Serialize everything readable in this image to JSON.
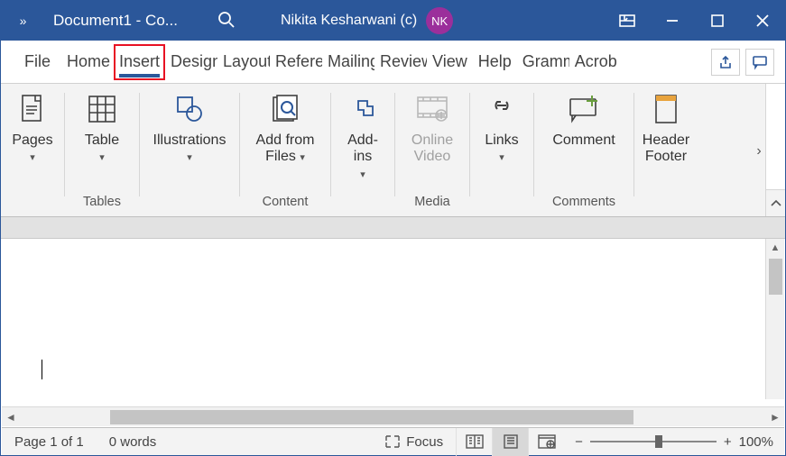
{
  "titlebar": {
    "overflow_glyph": "»",
    "doc_title": "Document1  -  Co...",
    "user_name": "Nikita Kesharwani (c)",
    "avatar_initials": "NK"
  },
  "tabs": {
    "file": "File",
    "items": [
      "Home",
      "Insert",
      "Design",
      "Layout",
      "Refere",
      "Mailing",
      "Review",
      "View",
      "Help",
      "Gramm",
      "Acrob"
    ],
    "active_index": 1
  },
  "ribbon": {
    "pages": {
      "label": "Pages"
    },
    "tables": {
      "group": "Tables",
      "table": "Table"
    },
    "illustrations": {
      "label": "Illustrations"
    },
    "content": {
      "group": "Content",
      "add_from_files": "Add from Files"
    },
    "addins": {
      "label": "Add-ins"
    },
    "media": {
      "group": "Media",
      "online_video": "Online Video"
    },
    "links": {
      "label": "Links"
    },
    "comments": {
      "group": "Comments",
      "comment": "Comment"
    },
    "header_footer": {
      "label": "Header Footer"
    }
  },
  "status": {
    "page_info": "Page 1 of 1",
    "word_count": "0 words",
    "focus_label": "Focus",
    "zoom_pct": "100%",
    "zoom_minus": "−",
    "zoom_plus": "+"
  }
}
